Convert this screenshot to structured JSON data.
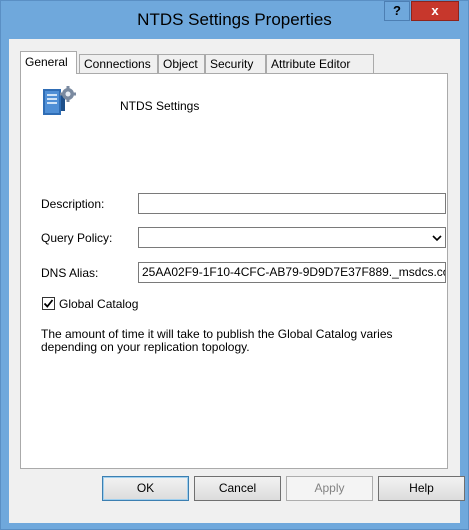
{
  "window": {
    "title": "NTDS Settings Properties",
    "help_label": "?",
    "close_label": "x"
  },
  "tabs": [
    {
      "label": "General",
      "active": true
    },
    {
      "label": "Connections",
      "active": false
    },
    {
      "label": "Object",
      "active": false
    },
    {
      "label": "Security",
      "active": false
    },
    {
      "label": "Attribute Editor",
      "active": false
    }
  ],
  "general": {
    "object_name": "NTDS Settings",
    "object_icon": "ntds-settings-icon",
    "description": {
      "label": "Description:",
      "value": ""
    },
    "query_policy": {
      "label": "Query Policy:",
      "value": ""
    },
    "dns_alias": {
      "label": "DNS Alias:",
      "value": "25AA02F9-1F10-4CFC-AB79-9D9D7E37F889._msdcs.co"
    },
    "global_catalog": {
      "label": "Global Catalog",
      "checked": true
    },
    "note": "The amount of time it will take to publish the Global Catalog varies depending on your replication topology."
  },
  "buttons": {
    "ok": "OK",
    "cancel": "Cancel",
    "apply": "Apply",
    "help": "Help"
  }
}
